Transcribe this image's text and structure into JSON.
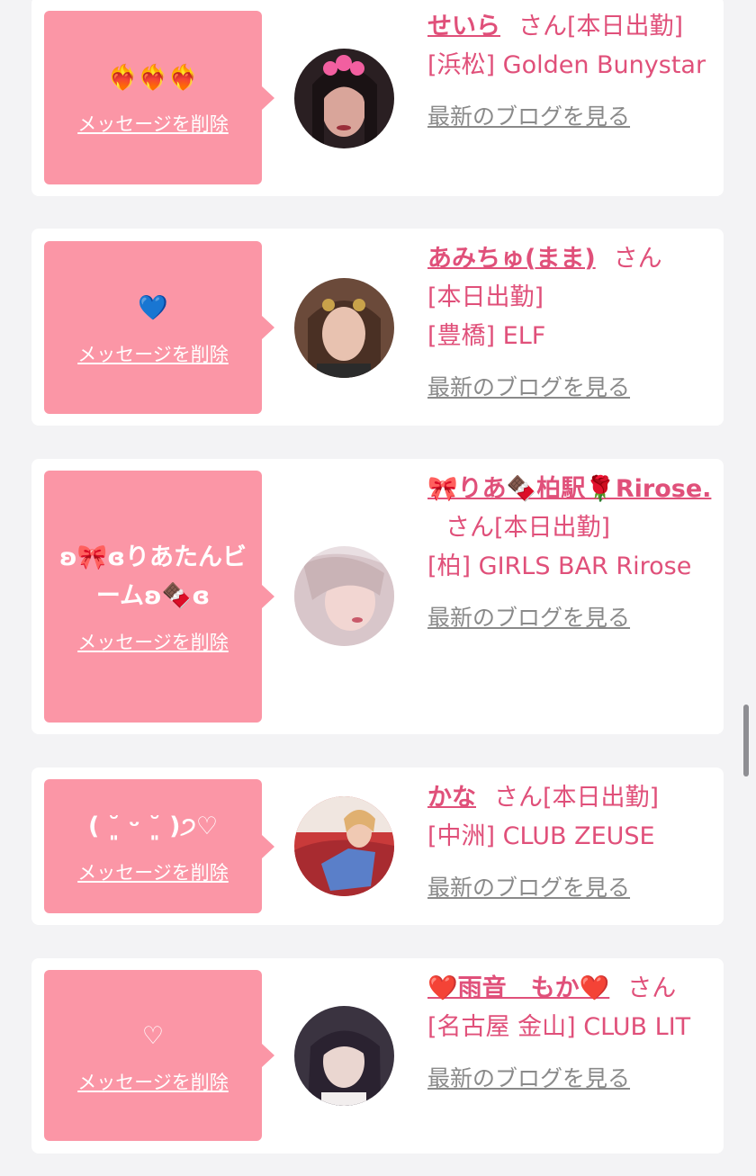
{
  "messages": [
    {
      "text": "❤️‍🔥❤️‍🔥❤️‍🔥",
      "delete_label": "メッセージを削除",
      "name": "せいら",
      "honorific": "さん",
      "status": "[本日出勤]",
      "shop": "[浜松] Golden Bunystar",
      "blog_label": "最新のブログを見る"
    },
    {
      "text": "💙",
      "delete_label": "メッセージを削除",
      "name": "あみちゅ(まま)",
      "honorific": "さん",
      "status": "[本日出勤]",
      "shop": "[豊橋] ELF",
      "blog_label": "最新のブログを見る"
    },
    {
      "text": "ʚ🎀ɞりあたんビームʚ🍫ɞ",
      "delete_label": "メッセージを削除",
      "name": "🎀りあ🍫柏駅🌹Rirose.",
      "honorific": "さん",
      "status": "[本日出勤]",
      "shop": "[柏] GIRLS BAR Rirose",
      "blog_label": "最新のブログを見る"
    },
    {
      "text": "( ˘͈ ᵕ ˘͈ )੭♡",
      "delete_label": "メッセージを削除",
      "name": "かな",
      "honorific": "さん",
      "status": "[本日出勤]",
      "shop": "[中洲] CLUB ZEUSE",
      "blog_label": "最新のブログを見る"
    },
    {
      "text": "♡",
      "delete_label": "メッセージを削除",
      "name": "❤️雨音　もか❤️",
      "honorific": "さん",
      "status": "",
      "shop": "[名古屋 金山] CLUB LIT",
      "blog_label": "最新のブログを見る"
    }
  ]
}
